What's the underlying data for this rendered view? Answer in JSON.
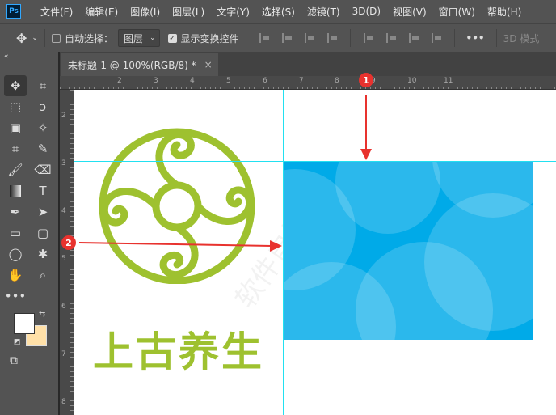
{
  "app": {
    "logo": "Ps"
  },
  "menu": [
    "文件(F)",
    "编辑(E)",
    "图像(I)",
    "图层(L)",
    "文字(Y)",
    "选择(S)",
    "滤镜(T)",
    "3D(D)",
    "视图(V)",
    "窗口(W)",
    "帮助(H)"
  ],
  "options": {
    "auto_select_label": "自动选择：",
    "auto_select_checked": false,
    "layer_select": "图层",
    "show_transform_label": "显示变换控件",
    "show_transform_checked": true,
    "more": "•••",
    "mode_3d": "3D 模式"
  },
  "document": {
    "tab_title": "未标题-1 @ 100%(RGB/8) *",
    "close": "×"
  },
  "rulers": {
    "h": [
      "2",
      "3",
      "4",
      "5",
      "6",
      "7",
      "8",
      "9",
      "10",
      "11"
    ],
    "v": [
      "2",
      "3",
      "4",
      "5",
      "6",
      "7",
      "8"
    ]
  },
  "canvas": {
    "brand_text": "上古养生",
    "watermark": "软件自学网",
    "brand_color": "#9ec12f",
    "rect_color": "#00aae8",
    "guide_color": "#22e0f0"
  },
  "annotations": {
    "badge1": "1",
    "badge2": "2",
    "arrow_color": "#e8322e"
  }
}
